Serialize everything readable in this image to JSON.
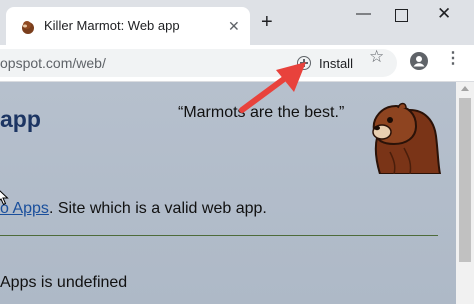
{
  "browser": {
    "tab": {
      "title": "Killer Marmot: Web app",
      "close_glyph": "✕"
    },
    "new_tab_glyph": "+",
    "window_controls": {
      "minimize": "—",
      "close": "✕"
    },
    "url": "opspot.com/web/",
    "install_label": "Install",
    "star_glyph": "☆",
    "menu_glyph": "⋮"
  },
  "page": {
    "heading": "app",
    "quote": "“Marmots are the best.”",
    "line1_link": "o Apps",
    "line1_rest": ". Site which is a valid web app.",
    "line2": "Apps is undefined"
  },
  "colors": {
    "page_bg": "#b2bccb",
    "heading": "#1c3563",
    "link": "#1a4f9c",
    "arrow": "#e8423c",
    "rule": "#4e6b3a"
  },
  "icons": [
    "marmot-favicon-icon",
    "close-icon",
    "plus-icon",
    "minimize-icon",
    "maximize-icon",
    "install-icon",
    "star-icon",
    "profile-icon",
    "menu-icon",
    "mouse-cursor-icon",
    "marmot-logo"
  ]
}
